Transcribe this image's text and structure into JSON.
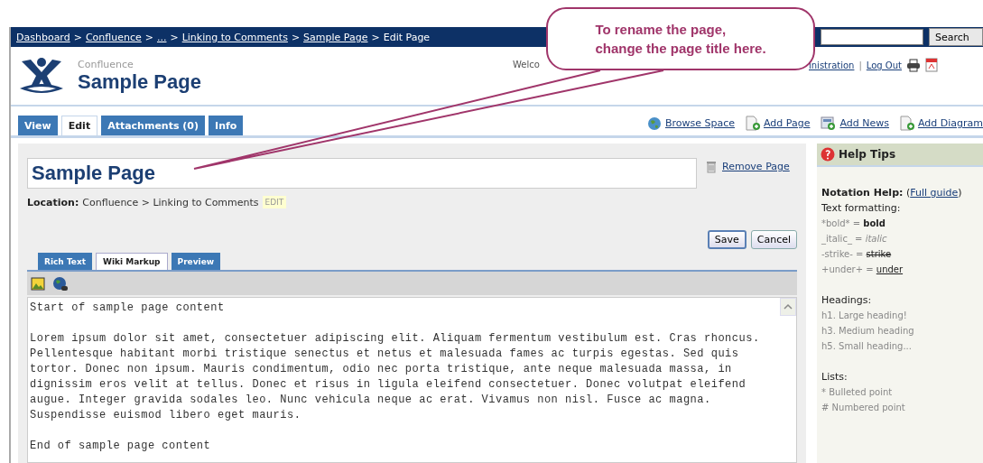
{
  "breadcrumb": [
    {
      "label": "Dashboard",
      "link": true
    },
    {
      "label": "Confluence",
      "link": true,
      "separator": ">"
    },
    {
      "label": "...",
      "link": true,
      "separator": ">"
    },
    {
      "label": "Linking to Comments",
      "link": true,
      "separator": ">"
    },
    {
      "label": "Sample Page",
      "link": true,
      "separator": ">"
    },
    {
      "label": "Edit Page",
      "link": false,
      "separator": ">"
    }
  ],
  "search": {
    "button": "Search"
  },
  "header": {
    "space": "Confluence",
    "title": "Sample Page",
    "welcome": "Welco",
    "user_links": [
      "inistration",
      "Log Out"
    ],
    "separator": "|"
  },
  "tabs": [
    {
      "label": "View",
      "selected": false
    },
    {
      "label": "Edit",
      "selected": true
    },
    {
      "label": "Attachments (0)",
      "selected": false
    },
    {
      "label": "Info",
      "selected": false
    }
  ],
  "actions": [
    {
      "label": "Browse Space"
    },
    {
      "label": "Add Page"
    },
    {
      "label": "Add News"
    },
    {
      "label": "Add Diagram"
    }
  ],
  "editor": {
    "title_value": "Sample Page",
    "remove_link": "Remove Page",
    "location_label": "Location:",
    "location": "Confluence > Linking to Comments",
    "location_edit": "EDIT",
    "buttons": [
      {
        "label": "Save",
        "primary": true
      },
      {
        "label": "Cancel",
        "primary": false
      }
    ],
    "mode_tabs": [
      {
        "label": "Rich Text",
        "selected": false
      },
      {
        "label": "Wiki Markup",
        "selected": true
      },
      {
        "label": "Preview",
        "selected": false
      }
    ],
    "content": "Start of sample page content\n\nLorem ipsum dolor sit amet, consectetuer adipiscing elit. Aliquam fermentum vestibulum est. Cras rhoncus.\nPellentesque habitant morbi tristique senectus et netus et malesuada fames ac turpis egestas. Sed quis\ntortor. Donec non ipsum. Mauris condimentum, odio nec porta tristique, ante neque malesuada massa, in\ndignissim eros velit at tellus. Donec et risus in ligula eleifend consectetuer. Donec volutpat eleifend\naugue. Integer gravida sodales leo. Nunc vehicula neque ac erat. Vivamus non nisl. Fusce ac magna.\nSuspendisse euismod libero eget mauris.\n\nEnd of sample page content"
  },
  "help": {
    "title": "Help Tips",
    "notation_label": "Notation Help:",
    "open_paren": "(",
    "guide_link": "Full guide",
    "close_paren": ")",
    "formatting_label": "Text formatting:",
    "formatting": [
      {
        "markup": "*bold* =",
        "result": "bold",
        "kind": "bold"
      },
      {
        "markup": "_italic_ =",
        "result": "italic",
        "kind": "italic"
      },
      {
        "markup": "-strike- =",
        "result": "strike",
        "kind": "strike"
      },
      {
        "markup": "+under+ =",
        "result": "under",
        "kind": "under"
      }
    ],
    "headings_label": "Headings:",
    "headings": [
      "h1. Large heading!",
      "h3. Medium heading",
      "h5. Small heading..."
    ],
    "lists_label": "Lists:",
    "lists": [
      "* Bulleted point",
      "# Numbered point"
    ]
  },
  "callout": {
    "text": "To rename the page,\nchange the page title here."
  }
}
